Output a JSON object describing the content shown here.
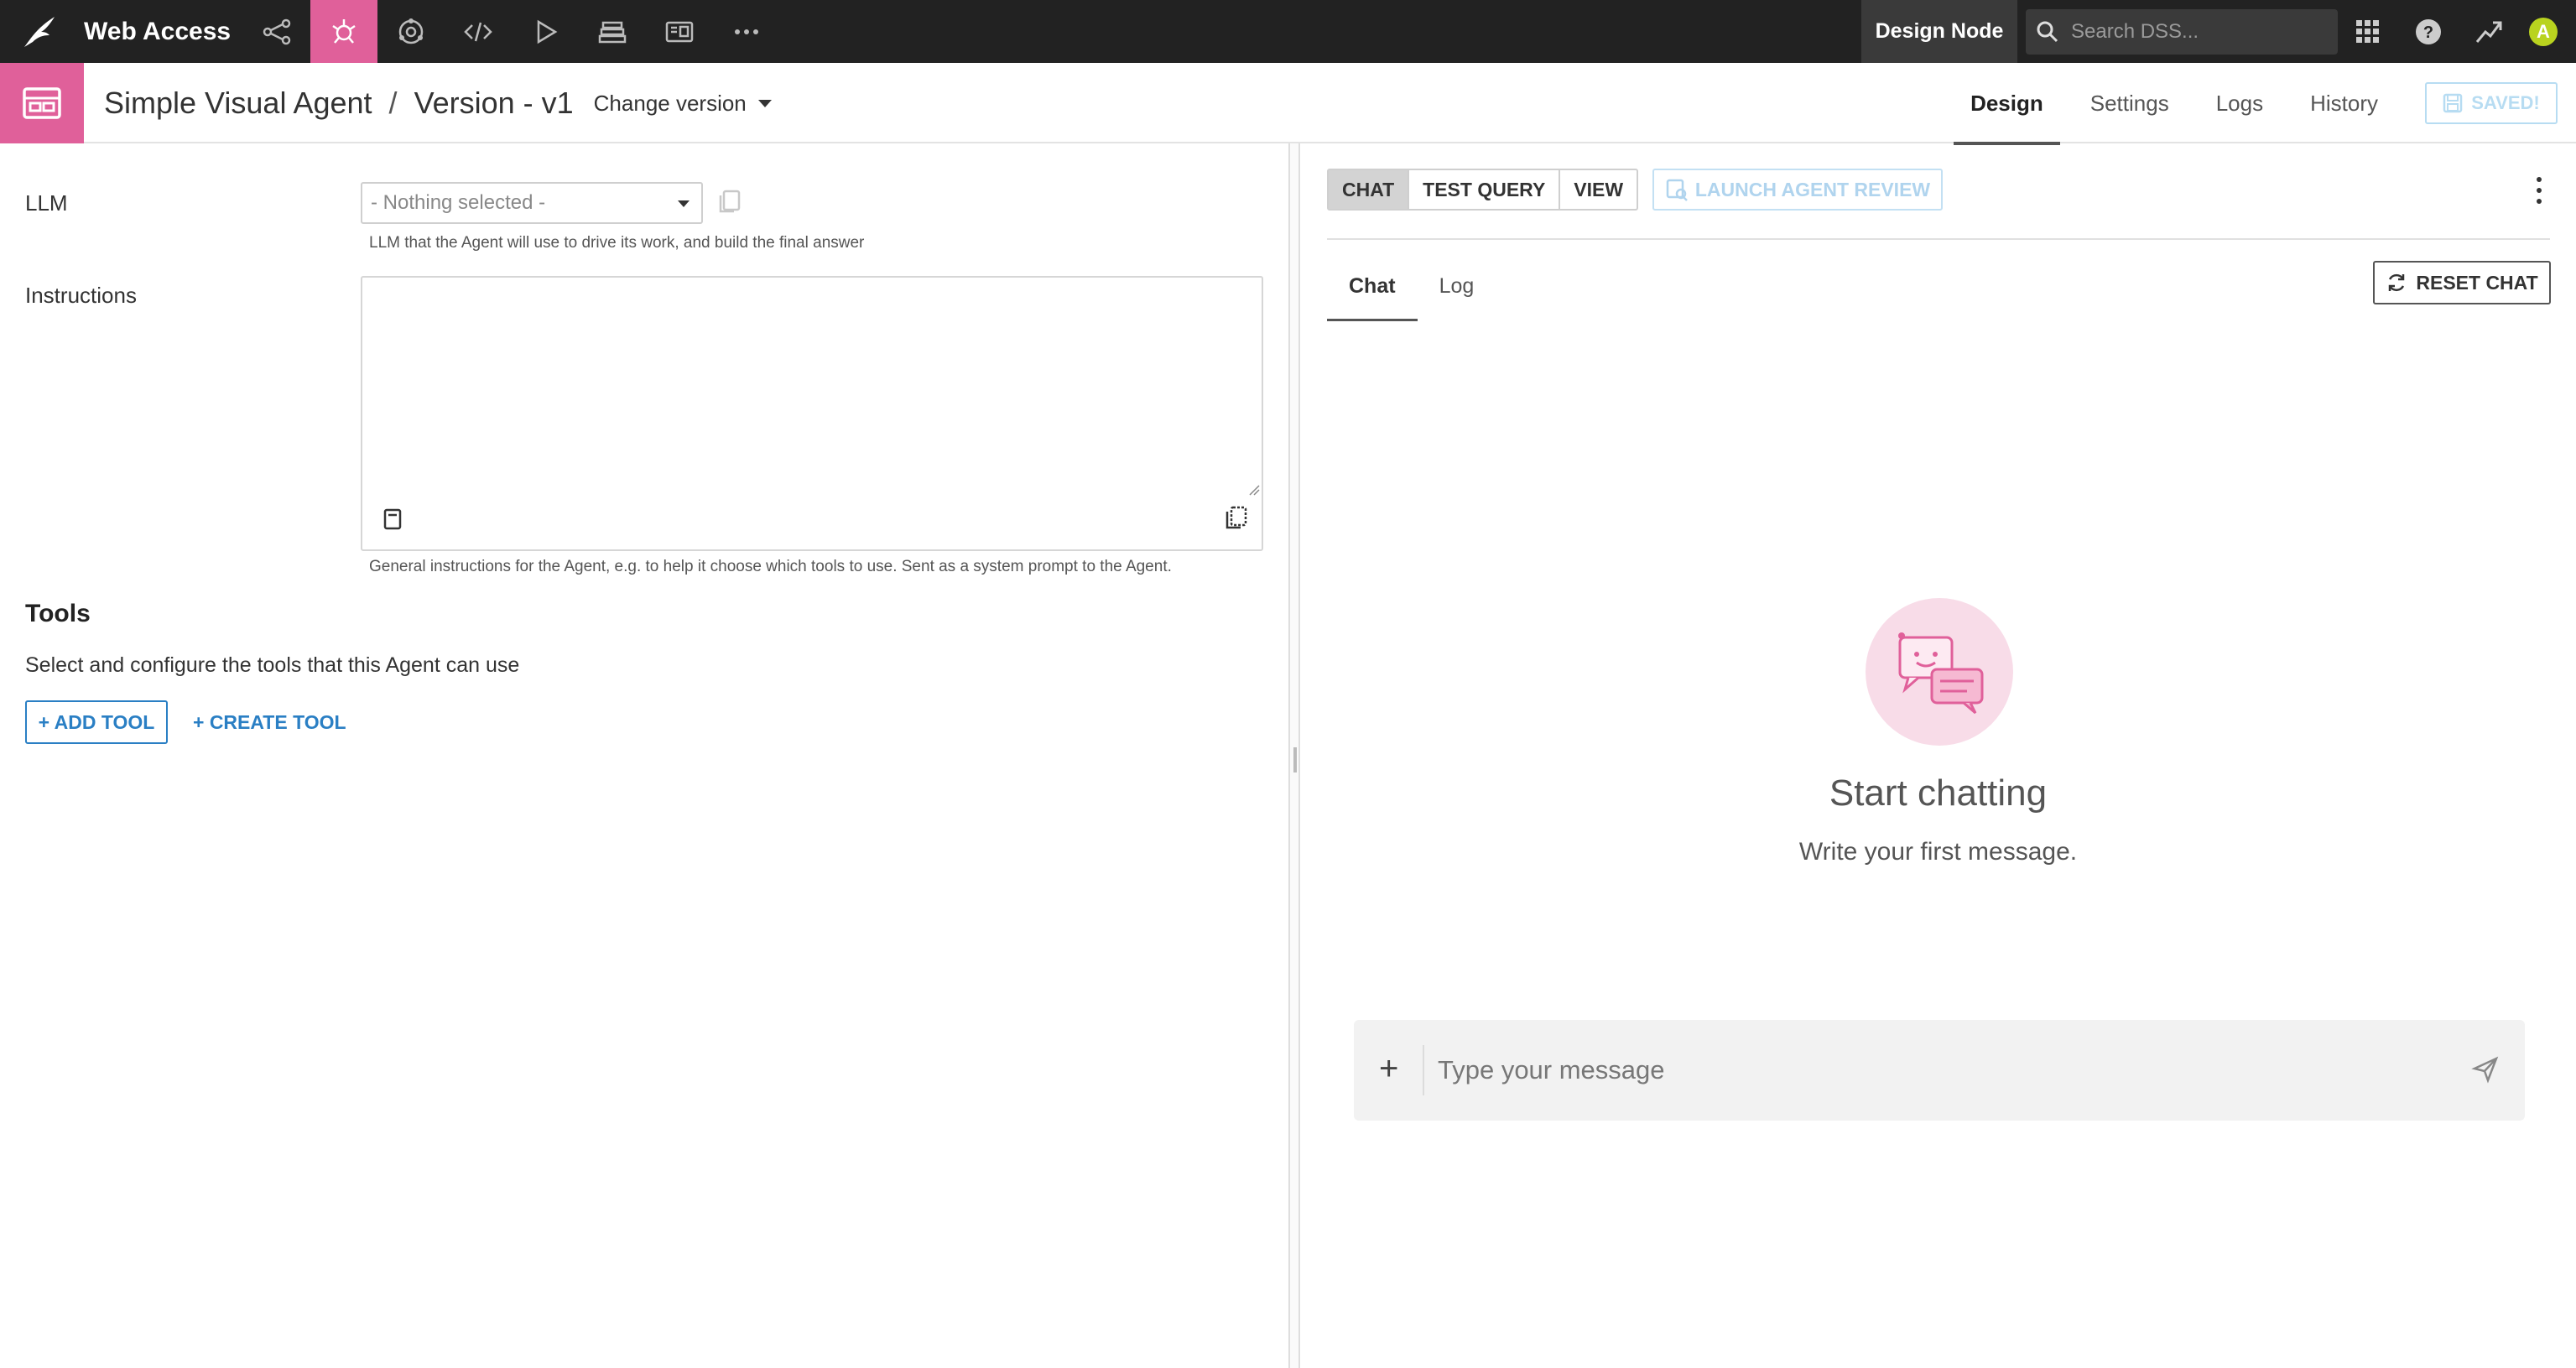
{
  "topbar": {
    "project_name": "Web Access",
    "nav": [
      {
        "name": "flow-icon"
      },
      {
        "name": "agent-icon",
        "active": true
      },
      {
        "name": "lab-icon"
      },
      {
        "name": "code-icon"
      },
      {
        "name": "run-icon"
      },
      {
        "name": "deploy-icon"
      },
      {
        "name": "dashboard-icon"
      },
      {
        "name": "more-icon"
      }
    ],
    "node_label": "Design Node",
    "search_placeholder": "Search DSS...",
    "avatar_initial": "A",
    "accent_color": "#e0609a"
  },
  "header": {
    "object_name": "Simple Visual Agent",
    "separator": "/",
    "version": "Version - v1",
    "change_version": "Change version",
    "tabs": [
      {
        "label": "Design",
        "active": true
      },
      {
        "label": "Settings"
      },
      {
        "label": "Logs"
      },
      {
        "label": "History"
      }
    ],
    "saved_label": "SAVED!"
  },
  "left": {
    "llm_label": "LLM",
    "llm_selected": "- Nothing selected -",
    "llm_help": "LLM that the Agent will use to drive its work, and build the final answer",
    "instructions_label": "Instructions",
    "instructions_value": "",
    "instructions_help": "General instructions for the Agent, e.g. to help it choose which tools to use. Sent as a system prompt to the Agent.",
    "tools_title": "Tools",
    "tools_desc": "Select and configure the tools that this Agent can use",
    "add_tool": "+ ADD TOOL",
    "create_tool": "+ CREATE TOOL"
  },
  "right": {
    "modes": [
      {
        "label": "CHAT",
        "active": true
      },
      {
        "label": "TEST QUERY"
      },
      {
        "label": "VIEW"
      }
    ],
    "launch_review": "LAUNCH AGENT REVIEW",
    "subtabs": [
      {
        "label": "Chat",
        "active": true
      },
      {
        "label": "Log"
      }
    ],
    "reset_chat": "RESET CHAT",
    "empty_title": "Start chatting",
    "empty_subtitle": "Write your first message.",
    "composer_placeholder": "Type your message",
    "composer_plus": "+"
  }
}
